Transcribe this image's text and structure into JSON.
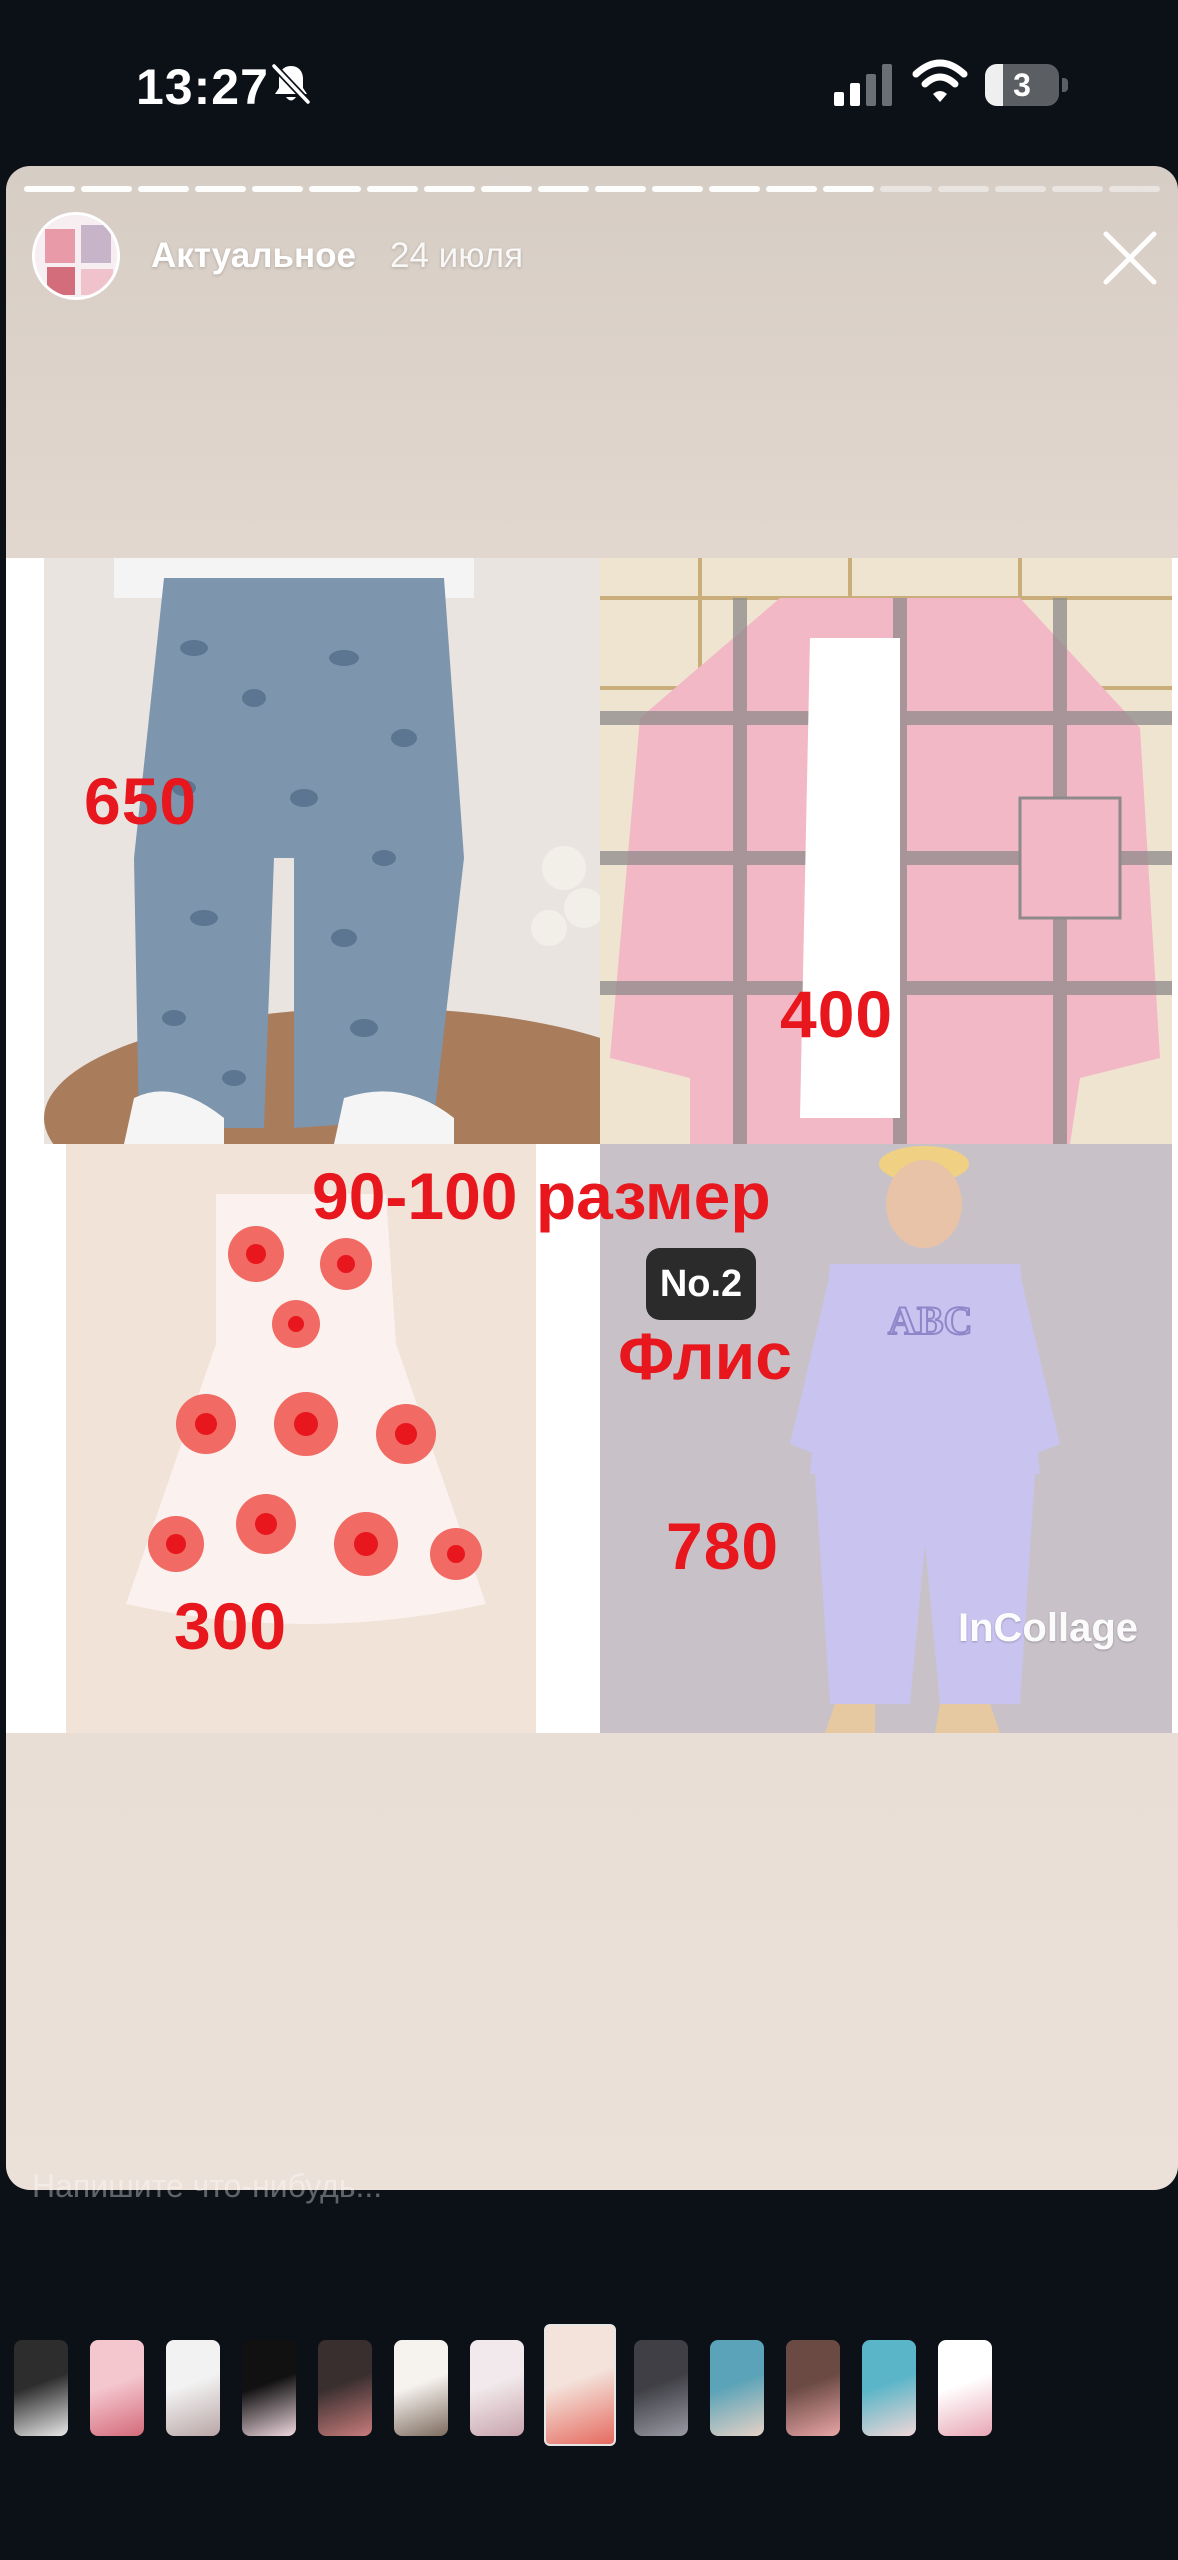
{
  "status_bar": {
    "time": "13:27",
    "battery": "3",
    "icons": [
      "bell-slash-icon",
      "signal-icon",
      "wifi-icon",
      "battery-icon"
    ]
  },
  "story": {
    "title": "Актуальное",
    "date": "24 июля",
    "progress_done": 15,
    "progress_total": 20,
    "close_icon": "close-icon"
  },
  "collage": {
    "prices": {
      "jeans": "650",
      "shirt": "400",
      "dress": "300",
      "tracksuit": "780"
    },
    "size_label": "90-100 размер",
    "badge": "No.2",
    "material": "Флис",
    "watermark": "InCollage",
    "hoodie_print": "ABC",
    "colors": {
      "price_red": "#e8161d",
      "plaid_pink": "#f2b8c6",
      "denim": "#7d95ad",
      "lilac": "#c9c3ef"
    }
  },
  "reply": {
    "placeholder": "Напишите что-нибудь..."
  },
  "thumbnails": {
    "count": 13,
    "active_index": 7
  }
}
